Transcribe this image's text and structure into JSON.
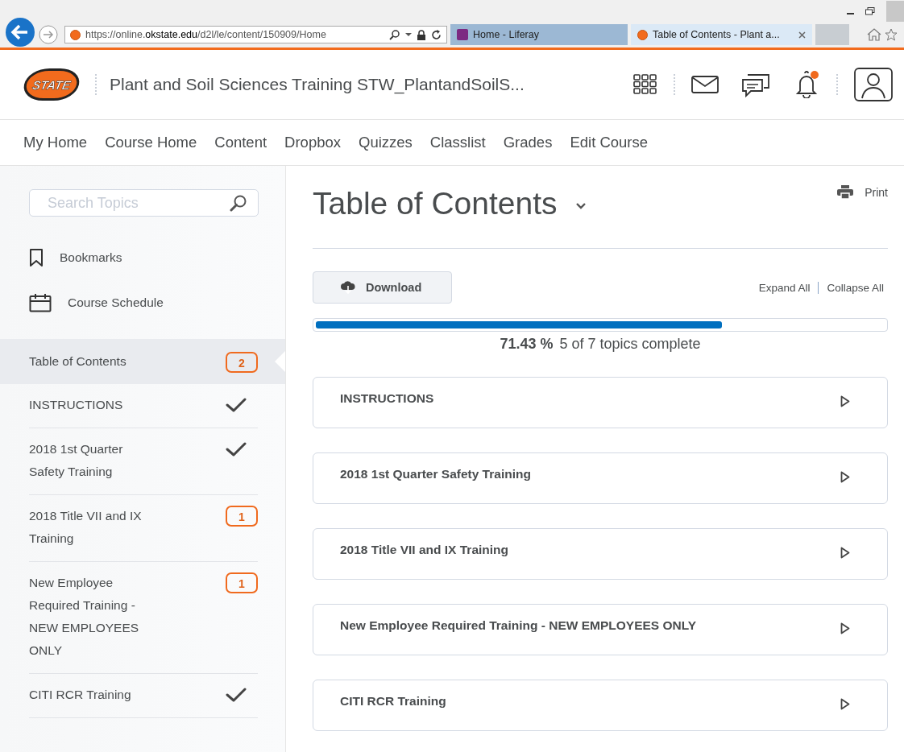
{
  "browser": {
    "url_prefix": "https://online.",
    "url_domain": "okstate.edu",
    "url_path": "/d2l/le/content/150909/Home",
    "tabs": [
      {
        "label": "Home - Liferay",
        "selected": false
      },
      {
        "label": "Table of Contents - Plant a...",
        "selected": true
      }
    ]
  },
  "header": {
    "logo_text": "STATE",
    "course_title": "Plant and Soil Sciences Training STW_PlantandSoilS...",
    "notification_unread": true
  },
  "nav": [
    "My Home",
    "Course Home",
    "Content",
    "Dropbox",
    "Quizzes",
    "Classlist",
    "Grades",
    "Edit Course"
  ],
  "sidebar": {
    "search": {
      "placeholder": "Search Topics"
    },
    "links": [
      {
        "label": "Bookmarks"
      },
      {
        "label": "Course Schedule"
      }
    ],
    "toc": {
      "label": "Table of Contents",
      "badge": "2",
      "selected": true
    },
    "modules": [
      {
        "label": "INSTRUCTIONS",
        "completed": true
      },
      {
        "label": "2018 1st Quarter Safety Training",
        "completed": true
      },
      {
        "label": "2018 Title VII and IX Training",
        "completed": false,
        "badge": "1"
      },
      {
        "label": "New Employee Required Training - NEW EMPLOYEES ONLY",
        "completed": false,
        "badge": "1"
      },
      {
        "label": "CITI RCR Training",
        "completed": true
      }
    ]
  },
  "main": {
    "title": "Table of Contents",
    "print": "Print",
    "download": "Download",
    "expand_all": "Expand All",
    "collapse_all": "Collapse All",
    "progress": {
      "level": 0.7143,
      "percent": "71.43 %",
      "summary": "5 of 7 topics complete"
    },
    "modules": [
      "INSTRUCTIONS",
      "2018 1st Quarter Safety Training",
      "2018 Title VII and IX Training",
      "New Employee Required Training - NEW EMPLOYEES ONLY",
      "CITI RCR Training"
    ]
  }
}
